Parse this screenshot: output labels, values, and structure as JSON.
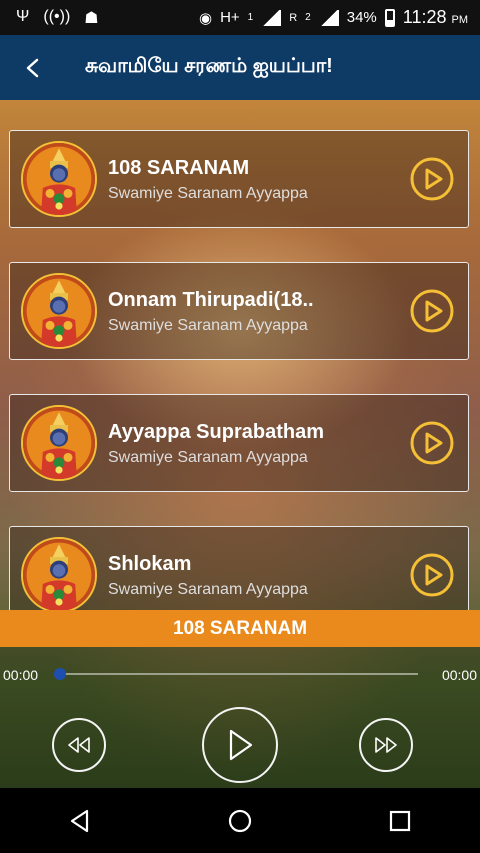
{
  "status_bar": {
    "icons_left": [
      "usb-icon",
      "wifi-hotspot-icon",
      "android-icon"
    ],
    "network1": "H+",
    "sim1": "1",
    "network2": "R",
    "sim2": "2",
    "battery": "34%",
    "time": "11:28",
    "ampm": "PM"
  },
  "app_bar": {
    "title": "சுவாமியே சரணம் ஐயப்பா!"
  },
  "tracks": [
    {
      "title": "108 SARANAM",
      "subtitle": "Swamiye Saranam Ayyappa"
    },
    {
      "title": "Onnam Thirupadi(18..",
      "subtitle": "Swamiye Saranam Ayyappa"
    },
    {
      "title": "Ayyappa Suprabatham",
      "subtitle": "Swamiye Saranam Ayyappa"
    },
    {
      "title": "Shlokam",
      "subtitle": "Swamiye Saranam Ayyappa"
    }
  ],
  "player": {
    "now_playing": "108 SARANAM",
    "elapsed": "00:00",
    "duration": "00:00",
    "progress": 0
  },
  "colors": {
    "app_bar": "#0e3a66",
    "accent_orange": "#ea8a1c",
    "play_icon": "#f5c036",
    "seek_thumb": "#1e4fb0"
  }
}
